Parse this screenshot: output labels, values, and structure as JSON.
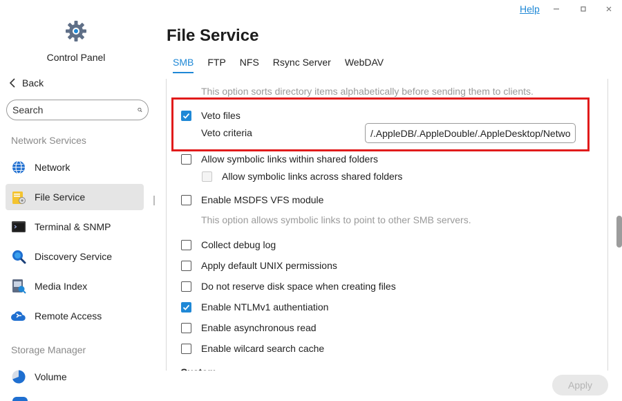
{
  "window": {
    "help_label": "Help",
    "controls": [
      "minimize-icon",
      "maximize-icon",
      "close-icon"
    ]
  },
  "sidebar": {
    "app_title": "Control Panel",
    "back_label": "Back",
    "search_placeholder": "Search",
    "sections": [
      {
        "title": "Network Services",
        "items": [
          {
            "label": "Network",
            "icon": "globe-icon",
            "active": false
          },
          {
            "label": "File Service",
            "icon": "folder-gear-icon",
            "active": true
          },
          {
            "label": "Terminal & SNMP",
            "icon": "terminal-icon",
            "active": false
          },
          {
            "label": "Discovery Service",
            "icon": "magnifier-icon",
            "active": false
          },
          {
            "label": "Media Index",
            "icon": "media-index-icon",
            "active": false
          },
          {
            "label": "Remote Access",
            "icon": "cloud-icon",
            "active": false
          }
        ]
      },
      {
        "title": "Storage Manager",
        "items": [
          {
            "label": "Volume",
            "icon": "volume-pie-icon",
            "active": false
          }
        ]
      }
    ]
  },
  "main": {
    "title": "File Service",
    "tabs": [
      {
        "label": "SMB",
        "active": true
      },
      {
        "label": "FTP",
        "active": false
      },
      {
        "label": "NFS",
        "active": false
      },
      {
        "label": "Rsync Server",
        "active": false
      },
      {
        "label": "WebDAV",
        "active": false
      }
    ],
    "sort_hint": "This option sorts directory items alphabetically before sending them to clients.",
    "veto": {
      "label": "Veto files",
      "checked": true,
      "criteria_label": "Veto criteria",
      "criteria_value": "/.AppleDB/.AppleDouble/.AppleDesktop/Network Trash Folder"
    },
    "options": {
      "symlinks_within": {
        "label": "Allow symbolic links within shared folders",
        "checked": false
      },
      "symlinks_across": {
        "label": "Allow symbolic links across shared folders",
        "checked": false,
        "disabled": true
      },
      "msdfs": {
        "label": "Enable MSDFS VFS module",
        "checked": false
      },
      "msdfs_hint": "This option allows symbolic links to point to other SMB servers.",
      "debug_log": {
        "label": "Collect debug log",
        "checked": false
      },
      "unix_perms": {
        "label": "Apply default UNIX permissions",
        "checked": false
      },
      "no_reserve": {
        "label": "Do not reserve disk space when creating files",
        "checked": false
      },
      "ntlmv1": {
        "label": "Enable NTLMv1 authentiation",
        "checked": true
      },
      "async_read": {
        "label": "Enable asynchronous read",
        "checked": false
      },
      "wildcard_cache": {
        "label": "Enable wilcard search cache",
        "checked": false
      }
    },
    "next_section": "Custom",
    "apply_label": "Apply"
  },
  "colors": {
    "accent": "#1f88d6",
    "highlight_border": "#e11b1b",
    "active_nav_bg": "#e5e5e5"
  }
}
